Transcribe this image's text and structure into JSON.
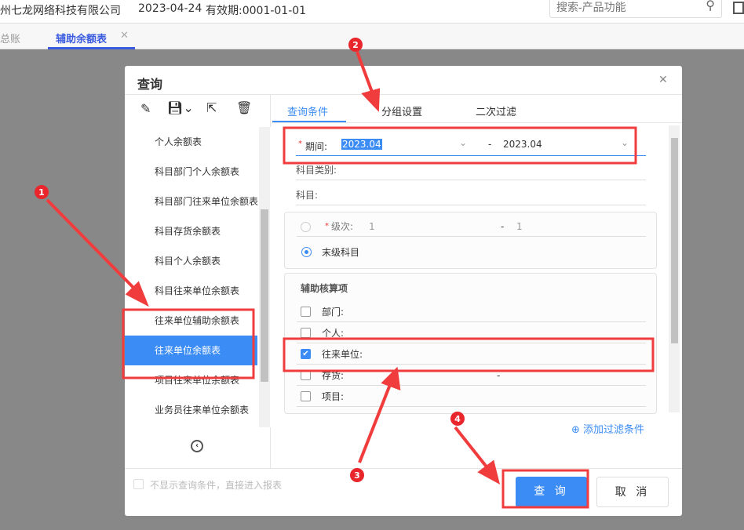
{
  "topbar": {
    "company": "州七龙网络科技有限公司",
    "date": "2023-04-24",
    "validity": "有效期:0001-01-01",
    "search_placeholder": "搜索-产品功能"
  },
  "tabs": [
    {
      "label": "总账"
    },
    {
      "label": "辅助余额表",
      "active": true
    }
  ],
  "dialog": {
    "title": "查询",
    "report_list": [
      "个人余额表",
      "科目部门个人余额表",
      "科目部门往来单位余额表",
      "科目存货余额表",
      "科目个人余额表",
      "科目往来单位余额表",
      "往来单位辅助余额表",
      "往来单位余额表",
      "项目往来单位余额表",
      "业务员往来单位余额表"
    ],
    "selected_report": "往来单位余额表",
    "right_tabs": [
      "查询条件",
      "分组设置",
      "二次过滤"
    ],
    "period_label": "期间:",
    "period_from": "2023.04",
    "period_sep": "-",
    "period_to": "2023.04",
    "subject_type_label": "科目类别:",
    "subject_label": "科目:",
    "level_label": "级次:",
    "level_from": "1",
    "level_sep": "-",
    "level_to": "1",
    "last_level_label": "末级科目",
    "aux_title": "辅助核算项",
    "aux_items": [
      {
        "label": "部门:",
        "checked": false
      },
      {
        "label": "个人:",
        "checked": false
      },
      {
        "label": "往来单位:",
        "checked": true
      },
      {
        "label": "存货:",
        "checked": false,
        "extra": "-"
      },
      {
        "label": "项目:",
        "checked": false
      }
    ],
    "add_filter": "添加过滤条件",
    "skip_label": "不显示查询条件，直接进入报表",
    "query_button": "查 询",
    "cancel_button": "取 消"
  },
  "annotations": [
    "1",
    "2",
    "3",
    "4"
  ],
  "colors": {
    "accent": "#3c8cf5",
    "annotation": "#f03c3c"
  }
}
